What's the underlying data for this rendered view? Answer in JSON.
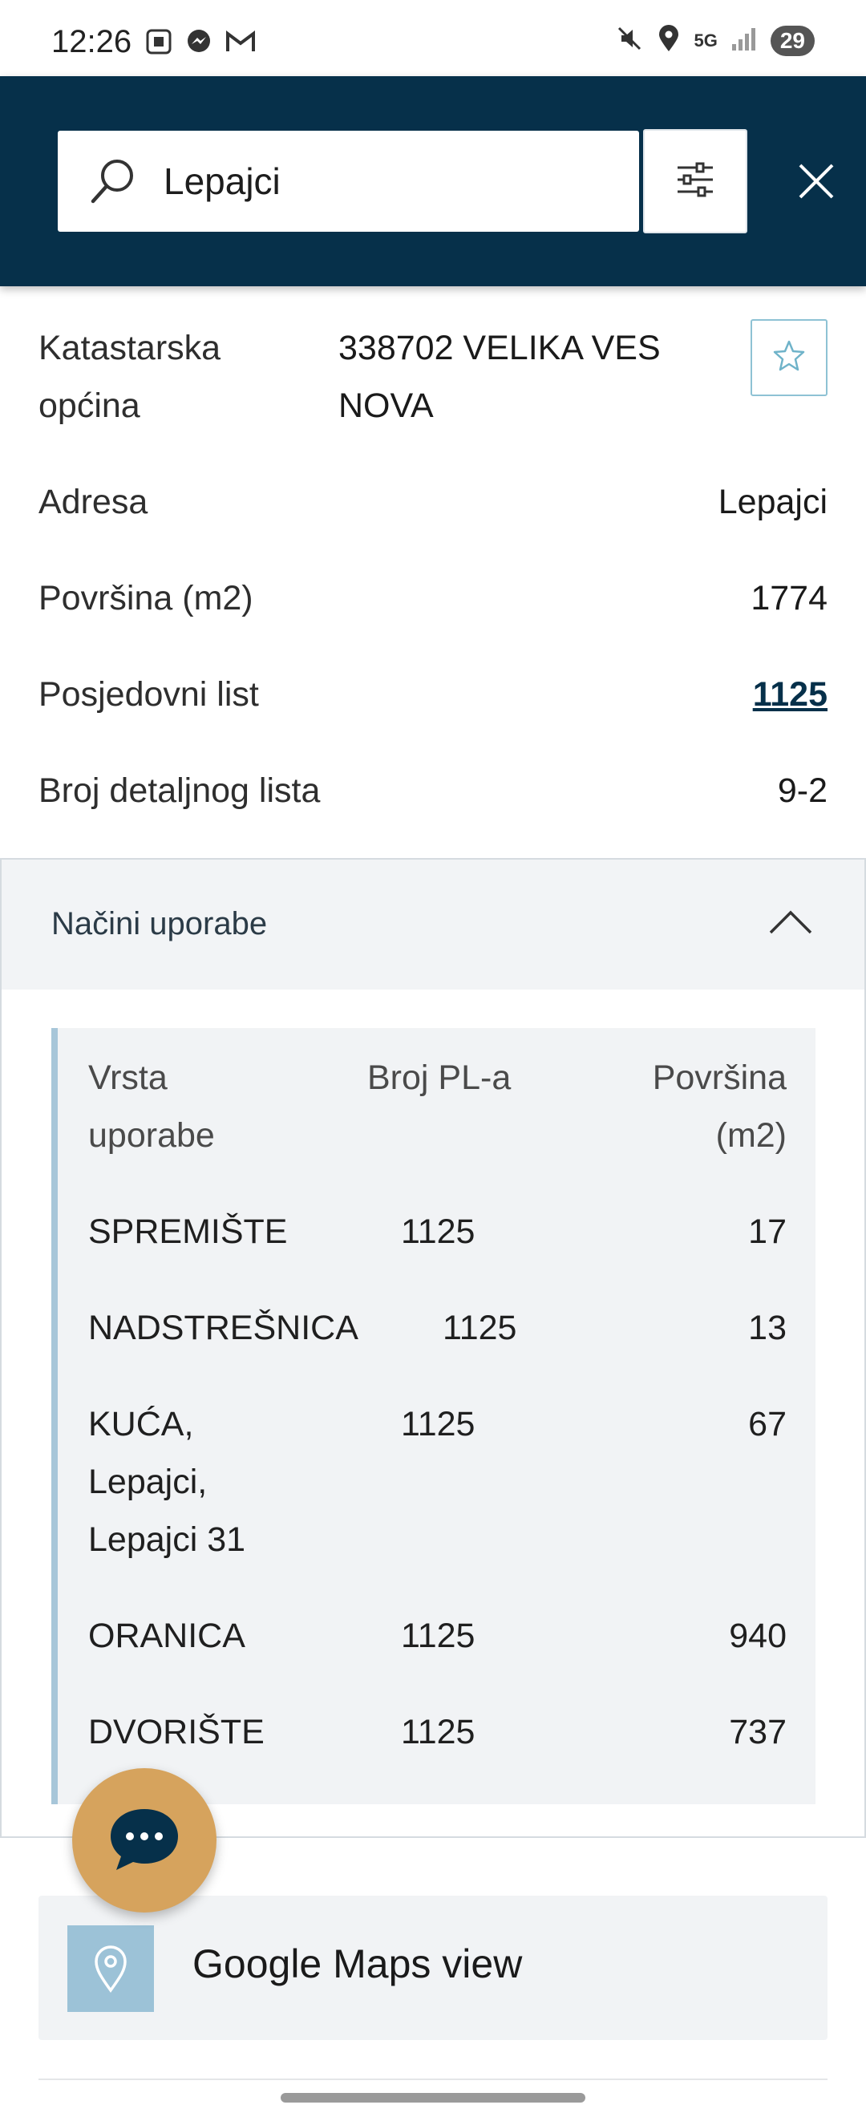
{
  "status_bar": {
    "time": "12:26",
    "battery": "29",
    "network": "5G"
  },
  "search": {
    "value": "Lepajci"
  },
  "details": {
    "cadastral_label": "Katastarska općina",
    "cadastral_label_line1": "Katastarska",
    "cadastral_label_line2": "općina",
    "cadastral_value_line1": "338702 VELIKA VES",
    "cadastral_value_line2": "NOVA",
    "address_label": "Adresa",
    "address_value": "Lepajci",
    "area_label": "Površina (m2)",
    "area_value": "1774",
    "possession_label": "Posjedovni list",
    "possession_value": "1125",
    "sheet_label": "Broj detaljnog lista",
    "sheet_value": "9-2"
  },
  "usage": {
    "title": "Načini uporabe",
    "headers": {
      "type_line1": "Vrsta",
      "type_line2": "uporabe",
      "pl": "Broj PL-a",
      "area_line1": "Površina",
      "area_line2": "(m2)"
    },
    "rows": [
      {
        "type": "SPREMIŠTE",
        "pl": "1125",
        "area": "17"
      },
      {
        "type": "NADSTREŠNICA",
        "pl": "1125",
        "area": "13"
      },
      {
        "type_line1": "KUĆA,",
        "type_line2": "Lepajci,",
        "type_line3": "Lepajci 31",
        "pl": "1125",
        "area": "67"
      },
      {
        "type": "ORANICA",
        "pl": "1125",
        "area": "940"
      },
      {
        "type": "DVORIŠTE",
        "pl": "1125",
        "area": "737"
      }
    ]
  },
  "maps": {
    "label": "Google Maps view"
  },
  "colors": {
    "header_bg": "#06304a",
    "accent_gold": "#d6a35d",
    "accent_light_blue": "#9cc2d7"
  }
}
